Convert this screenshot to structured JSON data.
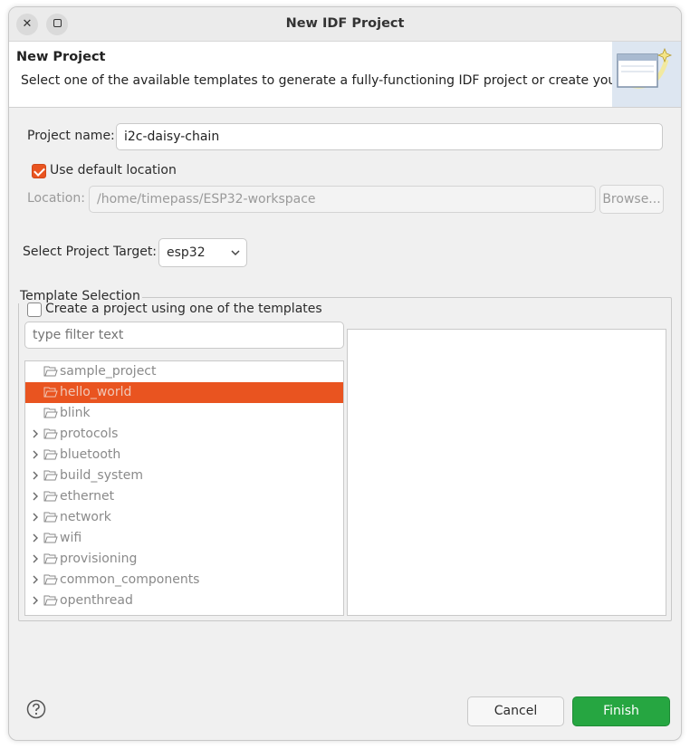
{
  "window": {
    "title": "New IDF Project"
  },
  "banner": {
    "title": "New Project",
    "description": "Select one of the available templates to generate a fully-functioning IDF project or create your own"
  },
  "project_name": {
    "label": "Project name:",
    "value": "i2c-daisy-chain"
  },
  "use_default_location": {
    "label": "Use default location",
    "checked": true
  },
  "location": {
    "label": "Location:",
    "value": "/home/timepass/ESP32-workspace",
    "browse_label": "Browse..."
  },
  "target": {
    "label": "Select Project Target:",
    "value": "esp32"
  },
  "template_selection": {
    "legend": "Template Selection",
    "use_templates_label": "Create a project using one of the templates",
    "use_templates_checked": false,
    "filter_placeholder": "type filter text",
    "items": [
      {
        "label": "sample_project",
        "expandable": false,
        "selected": false
      },
      {
        "label": "hello_world",
        "expandable": false,
        "selected": true
      },
      {
        "label": "blink",
        "expandable": false,
        "selected": false
      },
      {
        "label": "protocols",
        "expandable": true,
        "selected": false
      },
      {
        "label": "bluetooth",
        "expandable": true,
        "selected": false
      },
      {
        "label": "build_system",
        "expandable": true,
        "selected": false
      },
      {
        "label": "ethernet",
        "expandable": true,
        "selected": false
      },
      {
        "label": "network",
        "expandable": true,
        "selected": false
      },
      {
        "label": "wifi",
        "expandable": true,
        "selected": false
      },
      {
        "label": "provisioning",
        "expandable": true,
        "selected": false
      },
      {
        "label": "common_components",
        "expandable": true,
        "selected": false
      },
      {
        "label": "openthread",
        "expandable": true,
        "selected": false
      }
    ]
  },
  "footer": {
    "cancel_label": "Cancel",
    "finish_label": "Finish",
    "help_icon": "question-mark-icon"
  },
  "colors": {
    "accent": "#e95420",
    "primary_button": "#26a641",
    "dialog_bg": "#f0f0f0"
  }
}
